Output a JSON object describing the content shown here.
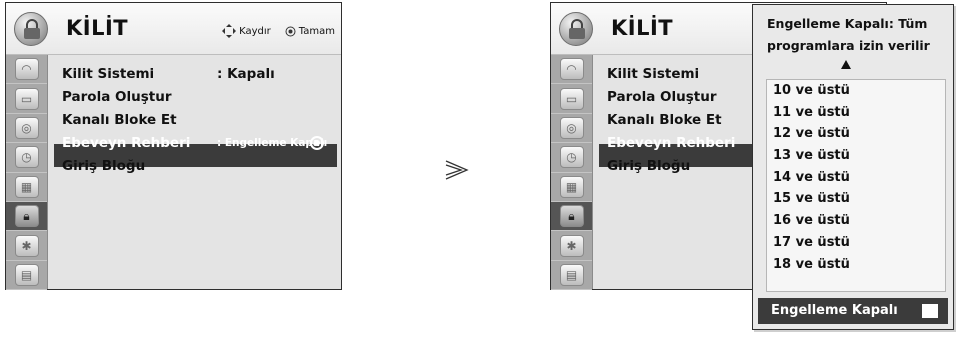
{
  "left_screen": {
    "title": "KİLİT",
    "hint": {
      "move_label": "Kaydır",
      "ok_label": "Tamam"
    },
    "menu": [
      {
        "label": "Kilit Sistemi",
        "value": ": Kapalı"
      },
      {
        "label": "Parola Oluştur",
        "value": ""
      },
      {
        "label": "Kanalı Bloke Et",
        "value": ""
      },
      {
        "label": "Ebeveyn Rehberi",
        "value": ": Engelleme Kapalı"
      },
      {
        "label": "Giriş Bloğu",
        "value": ""
      }
    ],
    "selected_index": 3
  },
  "right_screen": {
    "title": "KİLİT",
    "menu": [
      {
        "label": "Kilit Sistemi"
      },
      {
        "label": "Parola Oluştur"
      },
      {
        "label": "Kanalı Bloke Et"
      },
      {
        "label": "Ebeveyn Rehberi"
      },
      {
        "label": "Giriş Bloğu"
      }
    ],
    "selected_index": 3
  },
  "popup": {
    "title_line1": "Engelleme Kapalı: Tüm",
    "title_line2": "programlara izin verilir",
    "options": [
      "10 ve üstü",
      "11 ve üstü",
      "12 ve üstü",
      "13 ve üstü",
      "14 ve üstü",
      "15 ve üstü",
      "16 ve üstü",
      "17 ve üstü",
      "18 ve üstü"
    ],
    "footer_label": "Engelleme Kapalı"
  },
  "sidebar_icons": [
    "picture-satellite-icon",
    "tv-screen-icon",
    "speaker-icon",
    "clock-icon",
    "keypad-icon",
    "lock-icon",
    "bluetooth-icon",
    "clapperboard-icon"
  ],
  "active_sidebar_index": 5,
  "colors": {
    "highlight": "#3b3b3b",
    "background": "#e4e4e4",
    "sidebar": "#a8a8a8"
  }
}
